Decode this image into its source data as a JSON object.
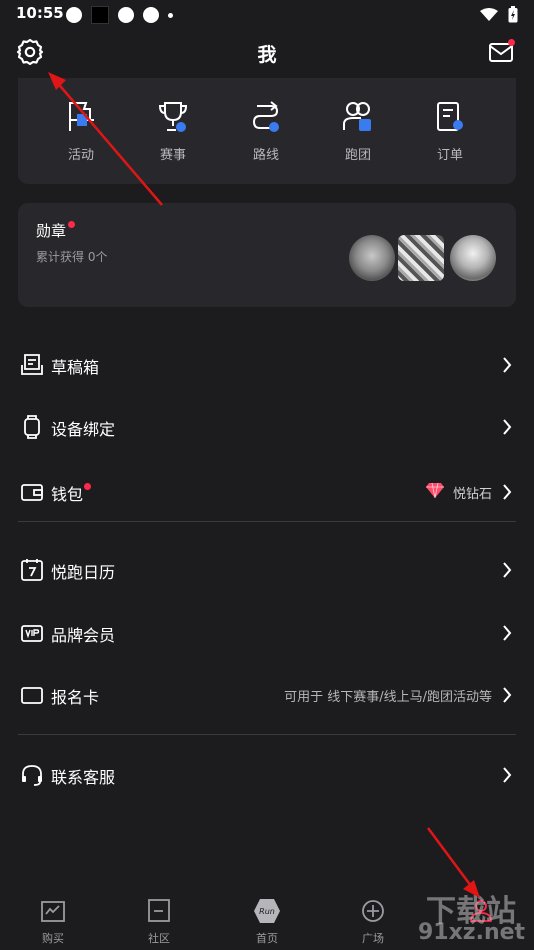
{
  "status_bar": {
    "time": "10:55"
  },
  "header": {
    "title": "我"
  },
  "quick_actions": [
    {
      "label": "活动",
      "icon": "activity-flag-icon"
    },
    {
      "label": "赛事",
      "icon": "trophy-icon"
    },
    {
      "label": "路线",
      "icon": "route-icon"
    },
    {
      "label": "跑团",
      "icon": "group-icon"
    },
    {
      "label": "订单",
      "icon": "order-icon"
    }
  ],
  "medal": {
    "title": "勋章",
    "subtitle": "累计获得 0个"
  },
  "menu": [
    {
      "label": "草稿箱",
      "value": "",
      "icon": "drafts-icon"
    },
    {
      "label": "设备绑定",
      "value": "",
      "icon": "watch-icon"
    },
    {
      "label": "钱包",
      "value": "悦钻石",
      "icon": "wallet-icon"
    },
    {
      "label": "悦跑日历",
      "value": "",
      "icon": "calendar-icon"
    },
    {
      "label": "品牌会员",
      "value": "",
      "icon": "vip-card-icon"
    },
    {
      "label": "报名卡",
      "value": "可用于 线下赛事/线上马/跑团活动等",
      "icon": "card-icon"
    },
    {
      "label": "联系客服",
      "value": "",
      "icon": "headset-icon"
    }
  ],
  "tabs": [
    {
      "label": "购买",
      "icon": "shop-bag-icon"
    },
    {
      "label": "社区",
      "icon": "community-icon"
    },
    {
      "label": "首页",
      "icon": "home-logo-icon"
    },
    {
      "label": "广场",
      "icon": "plaza-icon"
    },
    {
      "label": "",
      "icon": "profile-icon"
    }
  ],
  "watermark": {
    "line1": "下载站",
    "line2": "91xz.net"
  },
  "colors": {
    "background": "#1c1c1f",
    "card": "#28282c",
    "accent_blue": "#3b7bf0",
    "alert_red": "#ff2a4a",
    "annotation_red": "#e01515"
  }
}
